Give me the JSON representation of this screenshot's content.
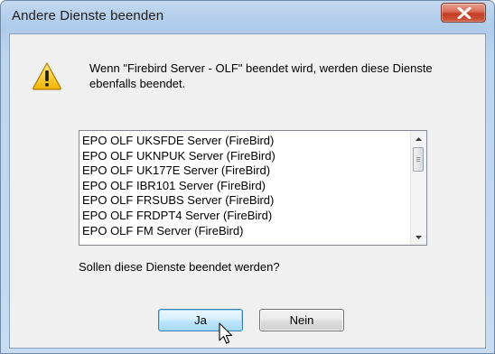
{
  "window": {
    "title": "Andere Dienste beenden",
    "close_icon": "close-x-icon"
  },
  "dialog": {
    "icon": "warning-icon",
    "message": "Wenn \"Firebird Server - OLF\" beendet wird, werden diese Dienste ebenfalls beendet.",
    "services": [
      "EPO OLF UKSFDE Server (FireBird)",
      "EPO OLF UKNPUK Server (FireBird)",
      "EPO OLF UK177E Server (FireBird)",
      "EPO OLF IBR101 Server (FireBird)",
      "EPO OLF FRSUBS Server (FireBird)",
      "EPO OLF FRDPT4 Server (FireBird)",
      "EPO OLF FM Server (FireBird)"
    ],
    "question": "Sollen diese Dienste beendet werden?",
    "yes_label": "Ja",
    "no_label": "Nein"
  },
  "colors": {
    "title_bar": "#b9d1ec",
    "close_button": "#c33c24",
    "focused_button": "#bee6fd"
  }
}
